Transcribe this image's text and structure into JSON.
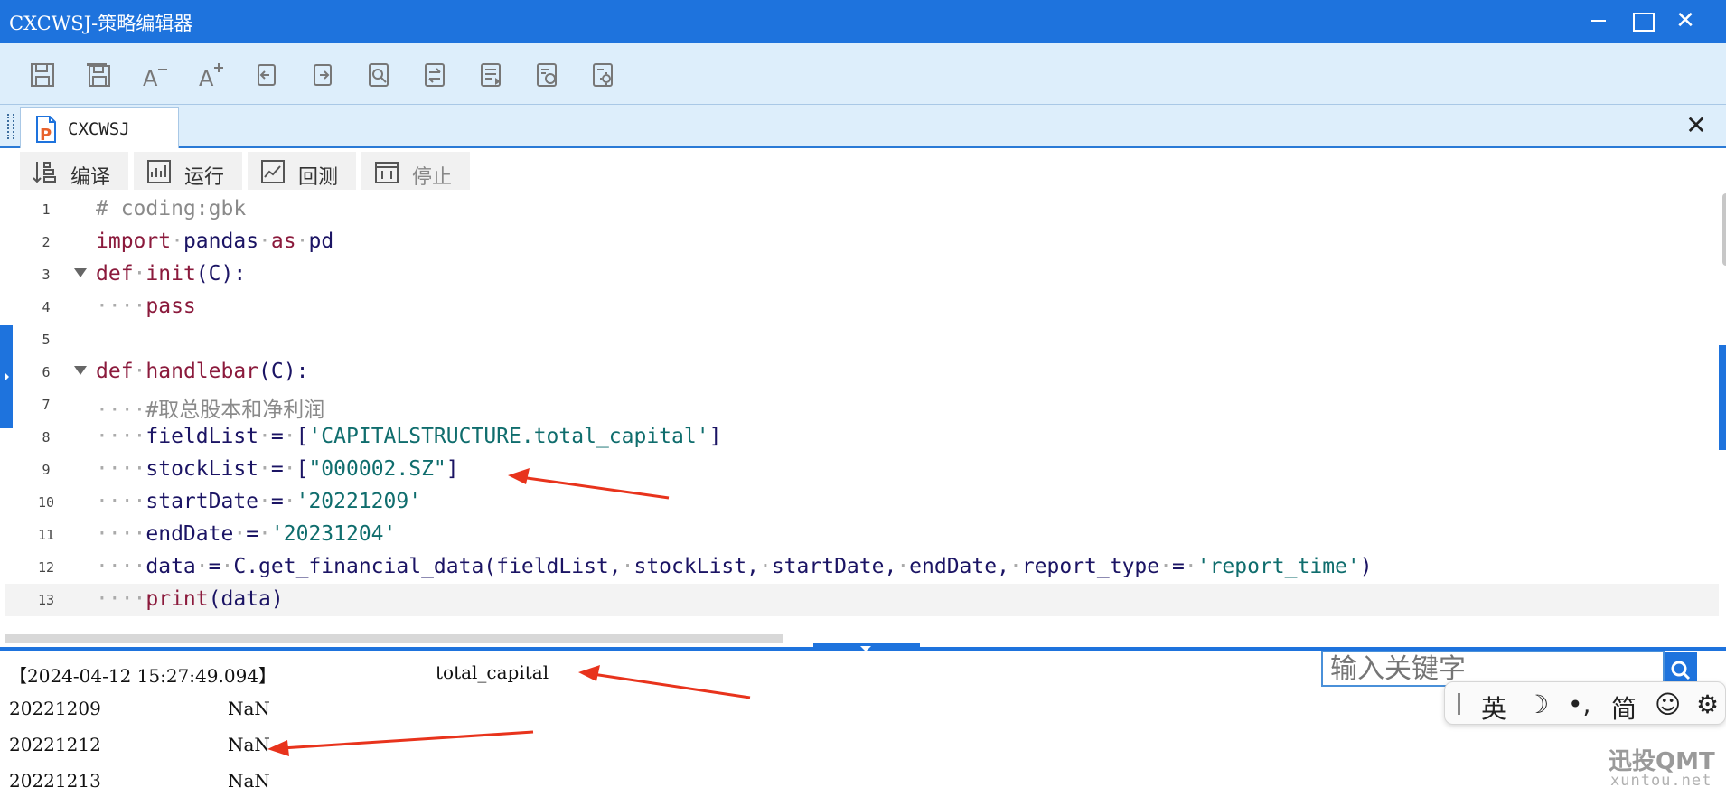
{
  "window": {
    "title": "CXCWSJ-策略编辑器",
    "close_symbol": "✕"
  },
  "toolbar": {
    "icons": [
      "save-icon",
      "save-all-icon",
      "font-decrease-icon",
      "font-increase-icon",
      "undo-icon",
      "redo-icon",
      "find-icon",
      "replace-icon",
      "format-icon",
      "settings-doc-icon",
      "settings-gear-icon"
    ]
  },
  "tab": {
    "label": "CXCWSJ",
    "close_symbol": "✕"
  },
  "actions": {
    "compile": "编译",
    "run": "运行",
    "backtest": "回测",
    "stop": "停止"
  },
  "editor": {
    "line_numbers": [
      "1",
      "2",
      "3",
      "4",
      "5",
      "6",
      "7",
      "8",
      "9",
      "10",
      "11",
      "12",
      "13"
    ],
    "current_line": 13
  },
  "output": {
    "header_time": "【2024-04-12 15:27:49.094】",
    "header_col": "total_capital",
    "rows": [
      {
        "date": "20221209",
        "value": "NaN"
      },
      {
        "date": "20221212",
        "value": "NaN"
      },
      {
        "date": "20221213",
        "value": "NaN"
      }
    ]
  },
  "search": {
    "placeholder": "输入关键字"
  },
  "ime": {
    "lang": "英",
    "moon": "☽",
    "punct": "•,",
    "simplified": "简",
    "emoji": "☺",
    "gear": "⚙"
  },
  "watermark": {
    "brand": "迅投QMT",
    "site": "xuntou.net"
  },
  "colors": {
    "accent": "#1e73dd",
    "arrow": "#e8331c",
    "keyword": "#8b1a3c",
    "string": "#0f6d6d"
  }
}
